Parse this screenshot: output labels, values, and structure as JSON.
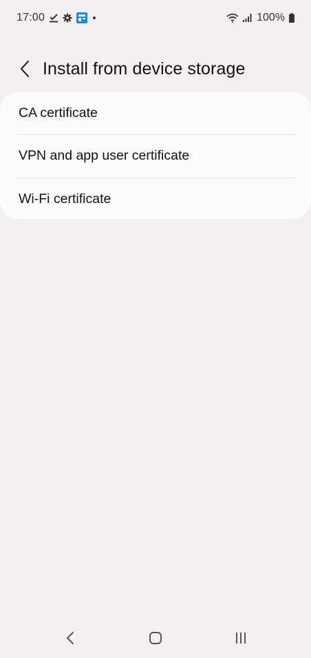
{
  "status_bar": {
    "time": "17:00",
    "battery": "100%",
    "icons": [
      "download-done-icon",
      "settings-gear-icon",
      "app-notification-icon",
      "dot-icon",
      "wifi-icon",
      "signal-icon",
      "battery-icon"
    ]
  },
  "header": {
    "title": "Install from device storage",
    "back_icon": "chevron-left-icon"
  },
  "list": {
    "items": [
      {
        "label": "CA certificate"
      },
      {
        "label": "VPN and app user certificate"
      },
      {
        "label": "Wi-Fi certificate"
      }
    ]
  },
  "nav_bar": {
    "buttons": [
      "back-icon",
      "home-icon",
      "recents-icon"
    ]
  },
  "colors": {
    "background": "#f4f0f1",
    "card": "#fcfcfc",
    "text": "#111111",
    "notification_accent": "#1e88e5"
  }
}
